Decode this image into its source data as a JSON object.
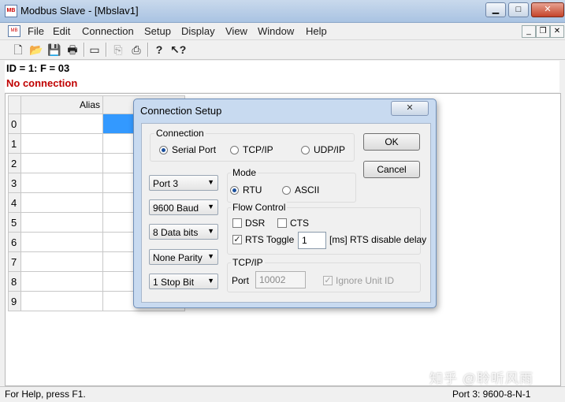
{
  "window": {
    "title": "Modbus Slave - [Mbslav1]",
    "app_icon_text": "MB"
  },
  "menu": {
    "items": [
      "File",
      "Edit",
      "Connection",
      "Setup",
      "Display",
      "View",
      "Window",
      "Help"
    ],
    "mdi_min": "_",
    "mdi_restore": "❐",
    "mdi_close": "✕"
  },
  "info": {
    "line1": "ID = 1: F = 03",
    "line2": "No connection"
  },
  "grid": {
    "alias_header": "Alias",
    "rows": [
      "0",
      "1",
      "2",
      "3",
      "4",
      "5",
      "6",
      "7",
      "8",
      "9"
    ]
  },
  "dialog": {
    "title": "Connection Setup",
    "connection_group": "Connection",
    "serial_port": "Serial Port",
    "tcpip": "TCP/IP",
    "udpip": "UDP/IP",
    "ok": "OK",
    "cancel": "Cancel",
    "port": "Port 3",
    "baud": "9600 Baud",
    "data_bits": "8 Data bits",
    "parity": "None Parity",
    "stop_bit": "1 Stop Bit",
    "mode_group": "Mode",
    "rtu": "RTU",
    "ascii": "ASCII",
    "flow_group": "Flow Control",
    "dsr": "DSR",
    "cts": "CTS",
    "rts_toggle": "RTS Toggle",
    "rts_delay_value": "1",
    "rts_delay_label": "[ms] RTS disable delay",
    "tcp_group": "TCP/IP",
    "port_label": "Port",
    "port_value": "10002",
    "ignore_unit_id": "Ignore Unit ID"
  },
  "status": {
    "help": "For Help, press F1.",
    "port_info": "Port 3: 9600-8-N-1"
  },
  "watermark": "知乎 @聆听风雨"
}
